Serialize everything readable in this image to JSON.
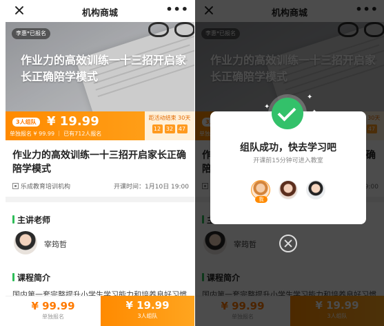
{
  "nav": {
    "title": "机构商城"
  },
  "hero": {
    "tag": "李惠*已报名",
    "title": "作业力的高效训练一十三招开启家长正确陪学模式"
  },
  "promo": {
    "badge": "3人组队",
    "price": "¥ 19.99",
    "sub": "单独报名 ¥ 99.99 ｜ 已有712人报名",
    "countdown_label": "距活动结束 30天",
    "countdown": [
      "12",
      "32",
      "47"
    ]
  },
  "course": {
    "title": "作业力的高效训练一十三招开启家长正确陪学模式",
    "org": "乐成教育培训机构",
    "start_time": "开课时间：1月10日 19:00"
  },
  "teacher": {
    "heading": "主讲老师",
    "name": "宰筠哲"
  },
  "intro": {
    "heading": "课程简介",
    "text": "国内第一套完整提升小学生学习能力和培养良好习惯"
  },
  "footer": {
    "single_price": "¥ 99.99",
    "single_label": "单独报名",
    "group_price": "¥ 19.99",
    "group_label": "3人组队"
  },
  "modal": {
    "title": "组队成功，快去学习吧",
    "sub": "开课前15分钟可进入教室",
    "me_badge": "我"
  },
  "colors": {
    "accent": "#ff8a00",
    "success": "#33c16a",
    "section_bar": "#2ebd58"
  }
}
